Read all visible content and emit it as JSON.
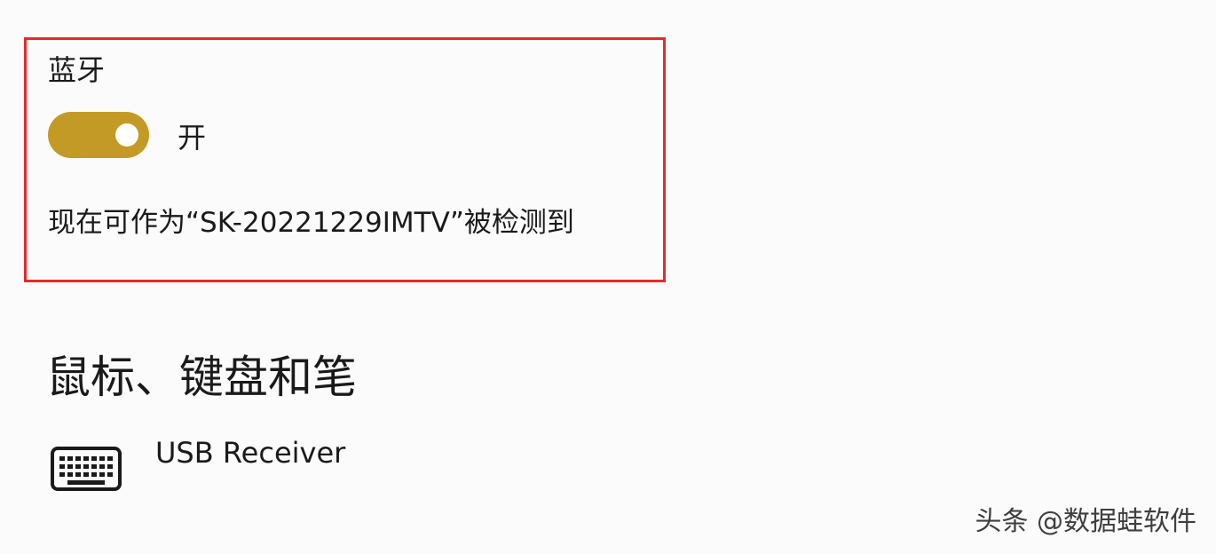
{
  "bluetooth": {
    "title": "蓝牙",
    "toggle_state": "开",
    "toggle_on": true,
    "discoverable_text": "现在可作为“SK-20221229IMTV”被检测到",
    "accent_color": "#c49a26",
    "highlight_color": "#e32b2b"
  },
  "section": {
    "heading": "鼠标、键盘和笔"
  },
  "devices": [
    {
      "name": "USB Receiver",
      "icon": "keyboard-icon"
    }
  ],
  "watermark": {
    "text": "头条 @数据蛙软件"
  }
}
